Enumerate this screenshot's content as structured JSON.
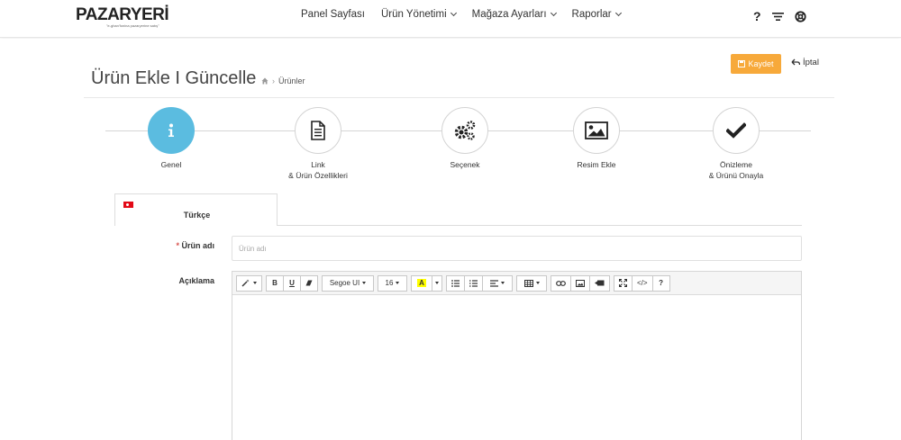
{
  "header": {
    "logo": "PAZARYERİ",
    "logo_tagline": "\"e-ghan'fonina pazaryerine satış\"",
    "nav": [
      {
        "label": "Panel Sayfası",
        "dropdown": false
      },
      {
        "label": "Ürün Yönetimi",
        "dropdown": true
      },
      {
        "label": "Mağaza Ayarları",
        "dropdown": true
      },
      {
        "label": "Raporlar",
        "dropdown": true
      }
    ],
    "help_icon": "?",
    "filter_icon": "filter-icon",
    "support_icon": "lifebuoy-icon"
  },
  "page": {
    "title": "Ürün Ekle I Güncelle",
    "breadcrumb": "Ürünler",
    "save_label": "Kaydet",
    "cancel_label": "İptal",
    "accent_color": "#f7a93a",
    "active_step_color": "#5bbce0"
  },
  "steps": [
    {
      "label": "Genel",
      "icon": "info-icon",
      "active": true
    },
    {
      "label": "Link\n& Ürün Özellikleri",
      "icon": "document-icon",
      "active": false
    },
    {
      "label": "Seçenek",
      "icon": "gears-icon",
      "active": false
    },
    {
      "label": "Resim Ekle",
      "icon": "image-icon",
      "active": false
    },
    {
      "label": "Önizleme\n& Ürünü Onayla",
      "icon": "checkmark-icon",
      "active": false
    }
  ],
  "language_tab": {
    "label": "Türkçe",
    "flag": "turkey-flag-icon"
  },
  "form": {
    "product_name_label": "Ürün adı",
    "required_mark": "*",
    "product_name_placeholder": "Ürün adı",
    "description_label": "Açıklama"
  },
  "editor_toolbar": {
    "font": "Segoe UI",
    "font_size": "16",
    "highlight_letter": "A",
    "bold": "B",
    "underline": "U",
    "help": "?",
    "code": "</>"
  }
}
